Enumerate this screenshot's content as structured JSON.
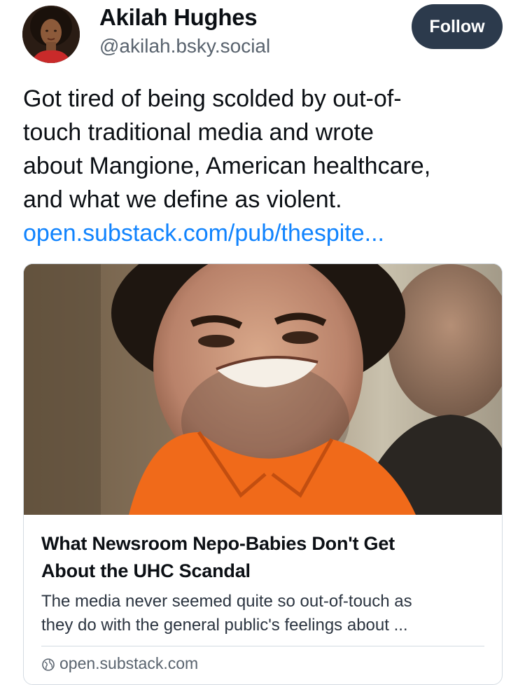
{
  "author": {
    "display_name": "Akilah Hughes",
    "handle": "@akilah.bsky.social"
  },
  "follow_label": "Follow",
  "post": {
    "text_lines": [
      "Got tired of being scolded by out-of-",
      "touch traditional media and wrote",
      "about Mangione, American healthcare,",
      "and what we define as violent."
    ],
    "link_text": "open.substack.com/pub/thespite..."
  },
  "link_card": {
    "title_lines": [
      "What Newsroom Nepo-Babies Don't Get",
      "About the UHC Scandal"
    ],
    "description_lines": [
      "The media never seemed quite so out-of-touch as",
      "they do with the general public's feelings about ..."
    ],
    "domain": "open.substack.com",
    "domain_icon": "globe-icon"
  },
  "colors": {
    "link": "#1083fe",
    "follow_button": "#2c3a4c",
    "secondary_text": "#59636e",
    "border": "#d4dbe2"
  }
}
